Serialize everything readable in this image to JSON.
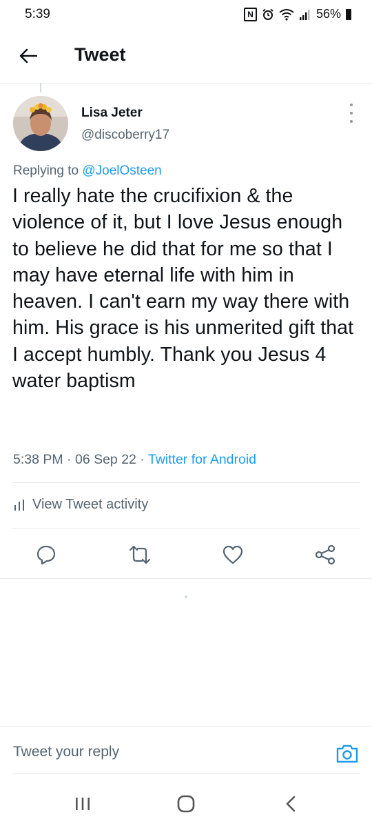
{
  "status_bar": {
    "time": "5:39",
    "battery_percent": "56%",
    "icons": [
      "nfc-icon",
      "alarm-icon",
      "wifi-icon",
      "signal-icon",
      "battery-icon"
    ]
  },
  "header": {
    "title": "Tweet",
    "back_icon": "arrow-left-icon"
  },
  "tweet": {
    "author_name": "Lisa Jeter",
    "author_handle": "@discoberry17",
    "replying_prefix": "Replying to ",
    "replying_to": "@JoelOsteen",
    "text": "I really hate the crucifixion & the violence of it, but I love Jesus enough to believe he did that for me so that I may have eternal life with him in heaven. I can't earn my way there with him. His grace is his unmerited gift that I accept humbly. Thank you Jesus 4 water baptism",
    "time": "5:38 PM",
    "separator": " · ",
    "date": "06 Sep 22",
    "source": "Twitter for Android"
  },
  "activity": {
    "label": "View Tweet activity",
    "icon": "bar-chart-icon"
  },
  "actions": {
    "reply_icon": "comment-icon",
    "retweet_icon": "retweet-icon",
    "like_icon": "heart-icon",
    "share_icon": "share-icon"
  },
  "reply_bar": {
    "placeholder": "Tweet your reply",
    "camera_icon": "camera-icon"
  },
  "navbar": {
    "icons": [
      "recents-icon",
      "home-icon",
      "back-icon"
    ]
  },
  "colors": {
    "accent": "#1d9bf0",
    "text_primary": "#0f1419",
    "text_secondary": "#536471",
    "divider": "#e7e9eb"
  }
}
